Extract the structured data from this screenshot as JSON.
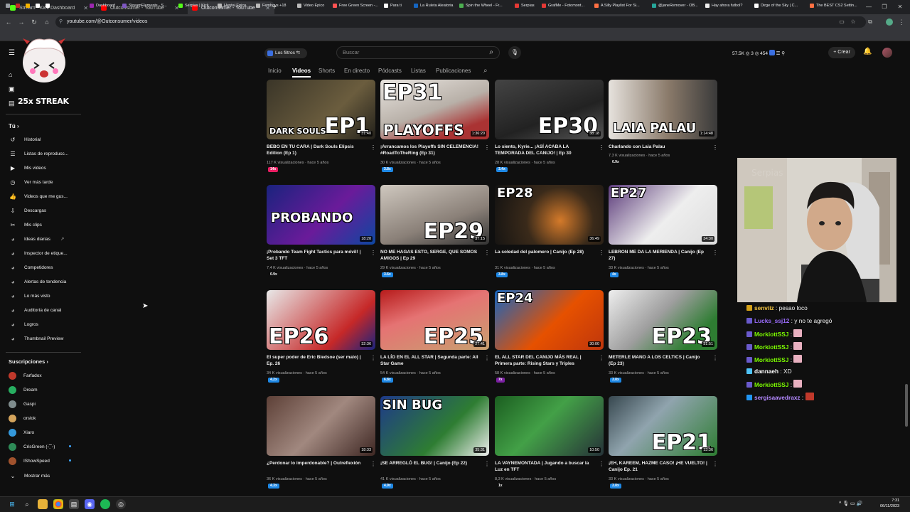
{
  "browser": {
    "tabs": [
      {
        "label": "Stream - Kick Dashboard",
        "color": "#53fc18"
      },
      {
        "label": "Outconsumer - YouTube",
        "color": "#ff0000"
      },
      {
        "label": "Outconsumer - YouTube",
        "color": "#ff0000"
      }
    ],
    "url": "youtube.com/@Outconsumer/videos",
    "bookmarks": [
      "Dashboard",
      "StreamElements - S...",
      "Serpias | Kick",
      "Hentai Epico",
      "Femboys +18",
      "Video Epico",
      "Free Green Screen -...",
      "Para ti",
      "La Ruleta Aleatoria",
      "Spin the Wheel - Fr...",
      "Serpias",
      "GrafMe - Fotomont...",
      "A Silly Playlist For Si...",
      "@janeRemover - OB...",
      "Hay ahora futbol?",
      "Dirge of the Sky | C...",
      "The BEST CS2 Settin..."
    ]
  },
  "overlay": {
    "logo_text": "25x STREAK"
  },
  "sidebar": {
    "you_label": "Tú",
    "items": [
      {
        "icon": "history-icon",
        "glyph": "↺",
        "label": "Historial"
      },
      {
        "icon": "playlist-icon",
        "glyph": "☰",
        "label": "Listas de reproducc..."
      },
      {
        "icon": "my-videos-icon",
        "glyph": "▶",
        "label": "Mis videos"
      },
      {
        "icon": "watch-later-icon",
        "glyph": "◷",
        "label": "Ver más tarde"
      },
      {
        "icon": "liked-icon",
        "glyph": "👍",
        "label": "Videos que me gus..."
      },
      {
        "icon": "downloads-icon",
        "glyph": "⇩",
        "label": "Descargas"
      },
      {
        "icon": "clips-icon",
        "glyph": "✂",
        "label": "Mis clips"
      }
    ],
    "ext_items": [
      "Ideas diarias",
      "Inspector de etique...",
      "Competidores",
      "Alertas de tendencia",
      "Lo más visto",
      "Auditoría de canal",
      "Logros",
      "Thumbnail Preview"
    ],
    "subs_label": "Suscripciones",
    "subs": [
      {
        "name": "Farfadox",
        "color": "#c0392b"
      },
      {
        "name": "Dream",
        "color": "#27ae60"
      },
      {
        "name": "Gaspi",
        "color": "#7f8c8d"
      },
      {
        "name": "orslok",
        "color": "#d4a45c"
      },
      {
        "name": "Xiaro",
        "color": "#3498db"
      },
      {
        "name": "CrisGreen (˵˘ฺ˘˵)",
        "color": "#2e8b57"
      },
      {
        "name": "IShowSpeed",
        "color": "#a0522d"
      }
    ],
    "more_label": "Mostrar más"
  },
  "topbar": {
    "filters_label": "Los filtros",
    "search_placeholder": "Buscar",
    "stats": "57.5K  ◎ 3  ◎ 454",
    "create_label": "Crear"
  },
  "channel_tabs": [
    "Inicio",
    "Videos",
    "Shorts",
    "En directo",
    "Pódcasts",
    "Listas",
    "Publicaciones"
  ],
  "videos": [
    {
      "title": "BEBO EN TU CARA | Dark Souls Elipsis Edition (Ep 1)",
      "meta": "117 K visualizaciones · hace 5 años",
      "badge": "14x",
      "badge_color": "#e91e63",
      "duration": "31:40",
      "big": "EP1",
      "sub": "DARK SOULS",
      "bg": "linear-gradient(135deg,#3a3528,#6b5d3e 60%,#22201a)"
    },
    {
      "title": "¡Arrancamos los Playoffs SIN CELEMENCIA! #RoadToTheRing (Ep 31)",
      "meta": "30 K visualizaciones · hace 5 años",
      "badge": "3.8x",
      "badge_color": "#1e88e5",
      "duration": "1:36:20",
      "big": "EP31",
      "sub": "PLAYOFFS",
      "bg": "linear-gradient(160deg,#e9e5e0,#b8b0a8 50%,#a33 80%)"
    },
    {
      "title": "Lo siento, Kyrie... ¡ASÍ ACABA LA TEMPORADA DEL CANIJO! | Ep 30",
      "meta": "28 K visualizaciones · hace 5 años",
      "badge": "3.4x",
      "badge_color": "#1e88e5",
      "duration": "38:18",
      "big": "EP30",
      "sub": "",
      "bg": "linear-gradient(160deg,#444,#222 60%,#555)"
    },
    {
      "title": "Charlando con Laia Palau",
      "meta": "7,3 K visualizaciones · hace 5 años",
      "badge": "0.9x",
      "badge_color": "#0f0f0f",
      "duration": "1:14:48",
      "big": "LAIA PALAU",
      "sub": "",
      "bg": "linear-gradient(90deg,#e6e2dd,#8a7a6a 55%,#3a3a3a)"
    },
    {
      "title": "¡Probando Team Fight Tactics para móvil! | Set 3 TFT",
      "meta": "7,4 K visualizaciones · hace 5 años",
      "badge": "0.9x",
      "badge_color": "#0f0f0f",
      "duration": "18:20",
      "big": "PROBANDO",
      "sub": "",
      "bg": "linear-gradient(135deg,#1a237e,#6a1b9a 55%,#0d47a1)"
    },
    {
      "title": "NO ME HAGAS ESTO, SERGE, QUE SOMOS AMIGOS | Ep 29",
      "meta": "29 K visualizaciones · hace 5 años",
      "badge": "3.6x",
      "badge_color": "#1e88e5",
      "duration": "37:15",
      "big": "EP29",
      "sub": "",
      "bg": "linear-gradient(160deg,#cfc8bf,#8a8078 60%,#333)"
    },
    {
      "title": "La soledad del palomero | Canijo (Ep 28)",
      "meta": "31 K visualizaciones · hace 5 años",
      "badge": "3.8x",
      "badge_color": "#1e88e5",
      "duration": "36:49",
      "big": "EP28",
      "sub": "",
      "bg": "radial-gradient(circle at 60% 60%,#d47a2a,#3a2a1a 45%,#111)"
    },
    {
      "title": "LEBRON ME DA LA MERIENDA | Canijo (Ep 27)",
      "meta": "33 K visualizaciones · hace 5 años",
      "badge": "4x",
      "badge_color": "#1e88e5",
      "duration": "34:30",
      "big": "EP27",
      "sub": "",
      "bg": "linear-gradient(135deg,#5b3a7a,#eeeeee 55%,#ddd)"
    },
    {
      "title": "El super poder de Eric Bledsoe (ser malo) | Ep. 26",
      "meta": "34 K visualizaciones · hace 5 años",
      "badge": "4.2x",
      "badge_color": "#1e88e5",
      "duration": "32:36",
      "big": "EP26",
      "sub": "",
      "bg": "linear-gradient(135deg,#e8e8e8,#c62828 70%,#1a237e)"
    },
    {
      "title": "LA LÍO EN EL ALL STAR | Segunda parte: All Star Game",
      "meta": "54 K visualizaciones · hace 5 años",
      "badge": "6.8x",
      "badge_color": "#1e88e5",
      "duration": "27:41",
      "big": "EP25",
      "sub": "",
      "bg": "linear-gradient(160deg,#b71c1c,#e57373 40%,#c8a070)"
    },
    {
      "title": "EL ALL STAR DEL CANIJO MÁS REAL | Primera parte: Rising Stars y Triples",
      "meta": "58 K visualizaciones · hace 5 años",
      "badge": "7x",
      "badge_color": "#7b1fa2",
      "duration": "30:00",
      "big": "EP24",
      "sub": "",
      "bg": "linear-gradient(135deg,#1565c0,#e65100 55%,#bf360c)"
    },
    {
      "title": "METERLE MANO A LOS CELTICS | Canijo (Ep 23)",
      "meta": "33 K visualizaciones · hace 5 años",
      "badge": "3.8x",
      "badge_color": "#1e88e5",
      "duration": "31:51",
      "big": "EP23",
      "sub": "",
      "bg": "linear-gradient(135deg,#eee,#9e9e9e 45%,#2e7d32 80%)"
    },
    {
      "title": "¿Perdonar lo imperdonable? | Outreflexión",
      "meta": "36 K visualizaciones · hace 5 años",
      "badge": "4.3x",
      "badge_color": "#1e88e5",
      "duration": "18:33",
      "big": "",
      "sub": "",
      "bg": "linear-gradient(135deg,#5d4037,#a1887f 50%,#3e2723)"
    },
    {
      "title": "¡SE ARREGLÓ EL BUG! | Canijo (Ep 22)",
      "meta": "41 K visualizaciones · hace 5 años",
      "badge": "4.9x",
      "badge_color": "#1e88e5",
      "duration": "35:31",
      "big": "SIN BUG",
      "sub": "",
      "bg": "linear-gradient(135deg,#1e3a8a,#2e7d32 60%,#eee)"
    },
    {
      "title": "LA VAYNEMONTADA | Jugando a buscar la Luz en TFT",
      "meta": "8,3 K visualizaciones · hace 5 años",
      "badge": "1x",
      "badge_color": "#0f0f0f",
      "duration": "10:50",
      "big": "",
      "sub": "",
      "bg": "linear-gradient(135deg,#1b5e20,#43a047 45%,#263238)"
    },
    {
      "title": "¡EH, KAREEM, HAZME CASO! ¡HE VUELTO! | Canijo Ep. 21",
      "meta": "33 K visualizaciones · hace 5 años",
      "badge": "3.8x",
      "badge_color": "#1e88e5",
      "duration": "13:36",
      "big": "EP21",
      "sub": "",
      "bg": "linear-gradient(135deg,#37474f,#90a4ae 40%,#2e7d32)"
    }
  ],
  "chat": [
    {
      "user": "senviiz",
      "text": " : pesao loco",
      "color": "#f4c542",
      "icon": "#d4a017"
    },
    {
      "user": "Lucks_ssj12",
      "text": " : y no te agregó",
      "color": "#9c6dff",
      "icon": "#6a5acd"
    },
    {
      "user": "MorkiottSSJ",
      "text": " : ",
      "color": "#7cfc00",
      "icon": "#6a5acd"
    },
    {
      "user": "MorkiottSSJ",
      "text": " : ",
      "color": "#7cfc00",
      "icon": "#6a5acd"
    },
    {
      "user": "MorkiottSSJ",
      "text": " : ",
      "color": "#7cfc00",
      "icon": "#6a5acd"
    },
    {
      "user": "dannaeh",
      "text": " : XD",
      "color": "#ffffff",
      "icon": "#4fc3f7"
    },
    {
      "user": "MorkiottSSJ",
      "text": " : ",
      "color": "#7cfc00",
      "icon": "#6a5acd"
    },
    {
      "user": "sergisaavedraxz",
      "text": " : ",
      "color": "#b388ff",
      "icon": "#2196f3"
    }
  ],
  "clock": {
    "time": "7:31",
    "date": "06/11/2023"
  }
}
